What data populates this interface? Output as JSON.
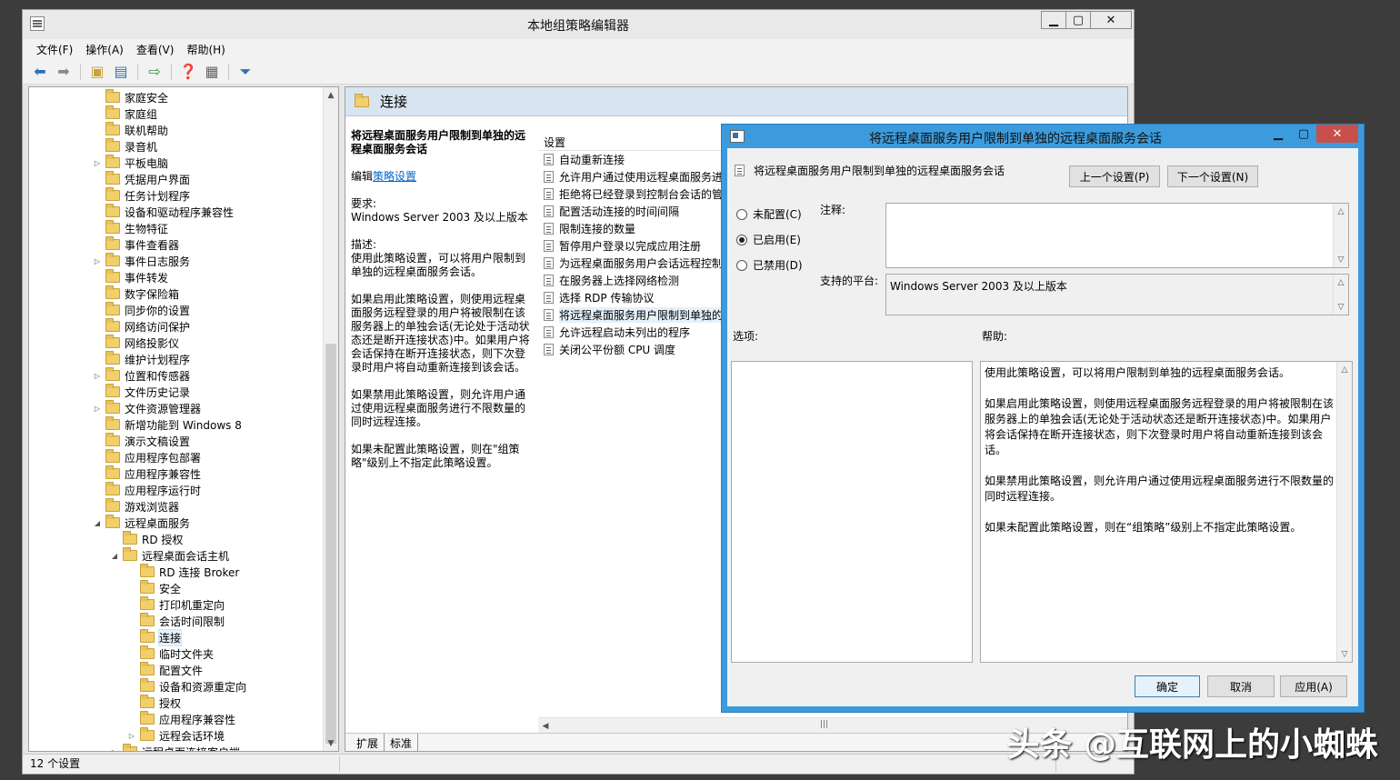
{
  "main": {
    "title": "本地组策略编辑器",
    "menu": [
      "文件(F)",
      "操作(A)",
      "查看(V)",
      "帮助(H)"
    ],
    "status": "12 个设置"
  },
  "tree": {
    "items": [
      {
        "label": "家庭安全",
        "level": 0,
        "exp": ""
      },
      {
        "label": "家庭组",
        "level": 0,
        "exp": ""
      },
      {
        "label": "联机帮助",
        "level": 0,
        "exp": ""
      },
      {
        "label": "录音机",
        "level": 0,
        "exp": ""
      },
      {
        "label": "平板电脑",
        "level": 0,
        "exp": "▷"
      },
      {
        "label": "凭据用户界面",
        "level": 0,
        "exp": ""
      },
      {
        "label": "任务计划程序",
        "level": 0,
        "exp": ""
      },
      {
        "label": "设备和驱动程序兼容性",
        "level": 0,
        "exp": ""
      },
      {
        "label": "生物特征",
        "level": 0,
        "exp": ""
      },
      {
        "label": "事件查看器",
        "level": 0,
        "exp": ""
      },
      {
        "label": "事件日志服务",
        "level": 0,
        "exp": "▷"
      },
      {
        "label": "事件转发",
        "level": 0,
        "exp": ""
      },
      {
        "label": "数字保险箱",
        "level": 0,
        "exp": ""
      },
      {
        "label": "同步你的设置",
        "level": 0,
        "exp": ""
      },
      {
        "label": "网络访问保护",
        "level": 0,
        "exp": ""
      },
      {
        "label": "网络投影仪",
        "level": 0,
        "exp": ""
      },
      {
        "label": "维护计划程序",
        "level": 0,
        "exp": ""
      },
      {
        "label": "位置和传感器",
        "level": 0,
        "exp": "▷"
      },
      {
        "label": "文件历史记录",
        "level": 0,
        "exp": ""
      },
      {
        "label": "文件资源管理器",
        "level": 0,
        "exp": "▷"
      },
      {
        "label": "新增功能到 Windows 8",
        "level": 0,
        "exp": ""
      },
      {
        "label": "演示文稿设置",
        "level": 0,
        "exp": ""
      },
      {
        "label": "应用程序包部署",
        "level": 0,
        "exp": ""
      },
      {
        "label": "应用程序兼容性",
        "level": 0,
        "exp": ""
      },
      {
        "label": "应用程序运行时",
        "level": 0,
        "exp": ""
      },
      {
        "label": "游戏浏览器",
        "level": 0,
        "exp": ""
      },
      {
        "label": "远程桌面服务",
        "level": 0,
        "exp": "◢"
      },
      {
        "label": "RD 授权",
        "level": 1,
        "exp": ""
      },
      {
        "label": "远程桌面会话主机",
        "level": 1,
        "exp": "◢"
      },
      {
        "label": "RD 连接 Broker",
        "level": 2,
        "exp": ""
      },
      {
        "label": "安全",
        "level": 2,
        "exp": ""
      },
      {
        "label": "打印机重定向",
        "level": 2,
        "exp": ""
      },
      {
        "label": "会话时间限制",
        "level": 2,
        "exp": ""
      },
      {
        "label": "连接",
        "level": 2,
        "exp": "",
        "selected": true
      },
      {
        "label": "临时文件夹",
        "level": 2,
        "exp": ""
      },
      {
        "label": "配置文件",
        "level": 2,
        "exp": ""
      },
      {
        "label": "设备和资源重定向",
        "level": 2,
        "exp": ""
      },
      {
        "label": "授权",
        "level": 2,
        "exp": ""
      },
      {
        "label": "应用程序兼容性",
        "level": 2,
        "exp": ""
      },
      {
        "label": "远程会话环境",
        "level": 2,
        "exp": "▷"
      },
      {
        "label": "远程桌面连接客户端",
        "level": 1,
        "exp": "▷"
      }
    ]
  },
  "right": {
    "header": "连接",
    "desc_title": "将远程桌面服务用户限制到单独的远程桌面服务会话",
    "edit_prefix": "编辑",
    "edit_link": "策略设置",
    "req_label": "要求:",
    "req_value": "Windows Server 2003 及以上版本",
    "desc_label": "描述:",
    "desc_1": "使用此策略设置，可以将用户限制到单独的远程桌面服务会话。",
    "desc_2": "如果启用此策略设置，则使用远程桌面服务远程登录的用户将被限制在该服务器上的单独会话(无论处于活动状态还是断开连接状态)中。如果用户将会话保持在断开连接状态，则下次登录时用户将自动重新连接到该会话。",
    "desc_3": "如果禁用此策略设置，则允许用户通过使用远程桌面服务进行不限数量的同时远程连接。",
    "desc_4": "如果未配置此策略设置，则在\"组策略\"级别上不指定此策略设置。",
    "settings_header": "设置",
    "settings": [
      "自动重新连接",
      "允许用户通过使用远程桌面服务进",
      "拒绝将已经登录到控制台会话的管",
      "配置活动连接的时间间隔",
      "限制连接的数量",
      "暂停用户登录以完成应用注册",
      "为远程桌面服务用户会话远程控制",
      "在服务器上选择网络检测",
      "选择 RDP 传输协议",
      "将远程桌面服务用户限制到单独的",
      "允许远程启动未列出的程序",
      "关闭公平份额 CPU 调度"
    ],
    "selected_index": 9,
    "tabs": [
      "扩展",
      "标准"
    ]
  },
  "dialog": {
    "title": "将远程桌面服务用户限制到单独的远程桌面服务会话",
    "policy_name": "将远程桌面服务用户限制到单独的远程桌面服务会话",
    "prev_button": "上一个设置(P)",
    "next_button": "下一个设置(N)",
    "radio_not_configured": "未配置(C)",
    "radio_enabled": "已启用(E)",
    "radio_disabled": "已禁用(D)",
    "comment_label": "注释:",
    "platform_label": "支持的平台:",
    "platform_value": "Windows Server 2003 及以上版本",
    "options_label": "选项:",
    "help_label": "帮助:",
    "help_1": "使用此策略设置，可以将用户限制到单独的远程桌面服务会话。",
    "help_2": "如果启用此策略设置，则使用远程桌面服务远程登录的用户将被限制在该服务器上的单独会话(无论处于活动状态还是断开连接状态)中。如果用户将会话保持在断开连接状态，则下次登录时用户将自动重新连接到该会话。",
    "help_3": "如果禁用此策略设置，则允许用户通过使用远程桌面服务进行不限数量的同时远程连接。",
    "help_4": "如果未配置此策略设置，则在“组策略”级别上不指定此策略设置。",
    "ok_button": "确定",
    "cancel_button": "取消",
    "apply_button": "应用(A)"
  },
  "watermark": "头条 @互联网上的小蜘蛛"
}
